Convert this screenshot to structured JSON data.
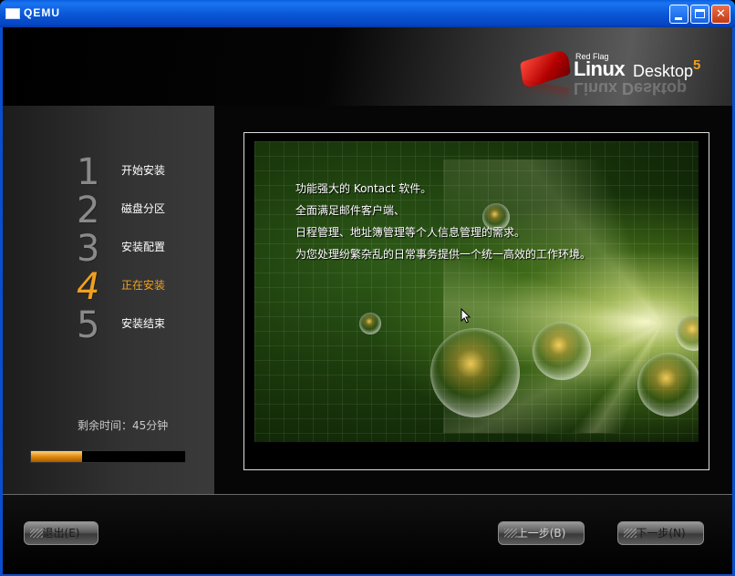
{
  "window": {
    "title": "QEMU"
  },
  "logo": {
    "brand_small": "Red Flag",
    "product": "Linux",
    "edition": "Desktop",
    "version": "5"
  },
  "steps": [
    {
      "number": "1",
      "label": "开始安装"
    },
    {
      "number": "2",
      "label": "磁盘分区"
    },
    {
      "number": "3",
      "label": "安装配置"
    },
    {
      "number": "4",
      "label": "正在安装"
    },
    {
      "number": "5",
      "label": "安装结束"
    }
  ],
  "active_step": 4,
  "remaining_time": "剩余时间：45分钟",
  "progress": {
    "fraction": 0.33
  },
  "slide": {
    "lines": [
      "功能强大的 Kontact 软件。",
      "全面满足邮件客户端、",
      "日程管理、地址簿管理等个人信息管理的需求。",
      "为您处理纷繁杂乱的日常事务提供一个统一高效的工作环境。"
    ]
  },
  "buttons": {
    "exit": "退出(E)",
    "prev": "上一步(B)",
    "next": "下一步(N)"
  },
  "colors": {
    "accent": "#f0a020",
    "title_bar": "#0a58d8"
  }
}
